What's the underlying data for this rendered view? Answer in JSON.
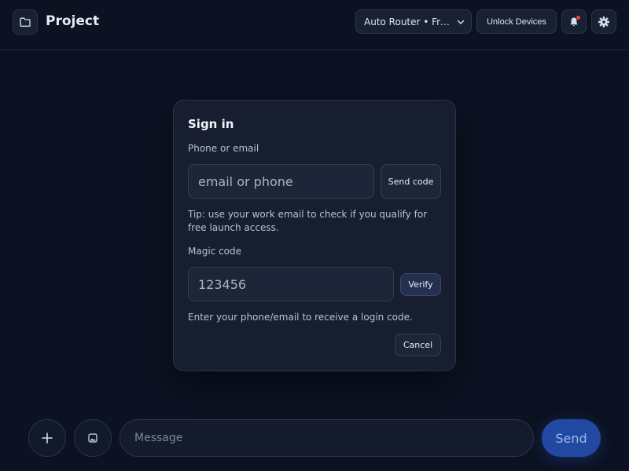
{
  "header": {
    "title": "Project",
    "model_selector": "Auto Router • Free ...",
    "unlock_button": "Unlock Devices",
    "icons": [
      "folder-icon",
      "bell-icon",
      "gear-icon"
    ]
  },
  "modal": {
    "title": "Sign in",
    "identifier_label": "Phone or email",
    "identifier_placeholder": "email or phone",
    "send_code_button": "Send code",
    "tip": "Tip: use your work email to check if you qualify for free launch access.",
    "code_label": "Magic code",
    "code_placeholder": "123456",
    "verify_button": "Verify",
    "hint": "Enter your phone/email to receive a login code.",
    "cancel_button": "Cancel"
  },
  "composer": {
    "add_icon": "plus-icon",
    "image_icon": "image-icon",
    "message_placeholder": "Message",
    "send_button": "Send"
  },
  "colors": {
    "background": "#0c1222",
    "panel": "#161e2f",
    "accent": "#2148a3",
    "notification": "#ef4444"
  }
}
